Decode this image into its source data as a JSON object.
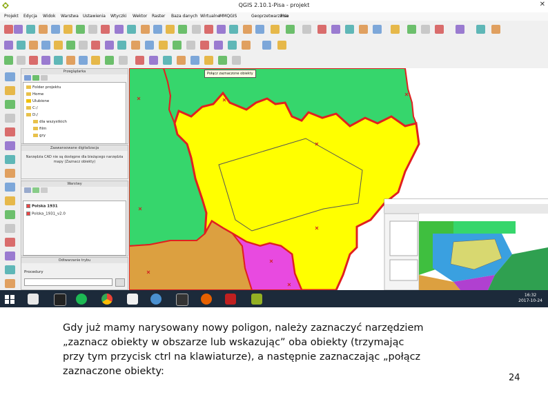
{
  "window": {
    "title": "QGIS 2.10.1-Pisa - projekt",
    "close_glyph": "✕"
  },
  "menu": [
    "Projekt",
    "Edycja",
    "Widok",
    "Warstwa",
    "Ustawienia",
    "Wtyczki",
    "Wektor",
    "Raster",
    "Baza danych",
    "Wirtualne",
    "MMQGIS",
    "Geoprzetwarzanie",
    "Pisa"
  ],
  "tooltip": "Połącz zaznaczone obiekty",
  "panels": {
    "browser": {
      "title": "Przeglądarka",
      "items": [
        "Folder projektu",
        "Home",
        "Ulubione",
        "C:/",
        "D:/",
        "dla wszystkich",
        "film",
        "gry"
      ]
    },
    "status": {
      "title": "Zaawansowane digitalizacja",
      "text": "Narzędzia CAD nie są dostępne dla bieżącego narzędzia mapy (Zaznacz obiekty)"
    },
    "layers": {
      "title": "Warstwy",
      "items": [
        "Polska 1931",
        "Polska_1931_v2.0"
      ]
    },
    "order": {
      "title": "Odtwarzanie trybu",
      "label": "Procedury"
    }
  },
  "taskbar": {
    "clock_time": "16:32",
    "clock_date": "2017-10-24"
  },
  "caption": {
    "lines": [
      "Gdy już mamy narysowany nowy poligon, należy zaznaczyć narzędziem",
      "„zaznacz obiekty w obszarze lub wskazując” oba obiekty (trzymając",
      "przy tym przycisk ctrl na klawiaturze), a następnie zaznaczając „połącz",
      "zaznaczone obiekty:"
    ],
    "page_number": "24"
  },
  "colors": {
    "green": "#36d66c",
    "dark_green": "#3fbf3f",
    "yellow": "#ffff00",
    "orange": "#dca040",
    "magenta": "#e84ae0",
    "red_border": "#e02020",
    "taskbar": "#1c2a3a"
  }
}
